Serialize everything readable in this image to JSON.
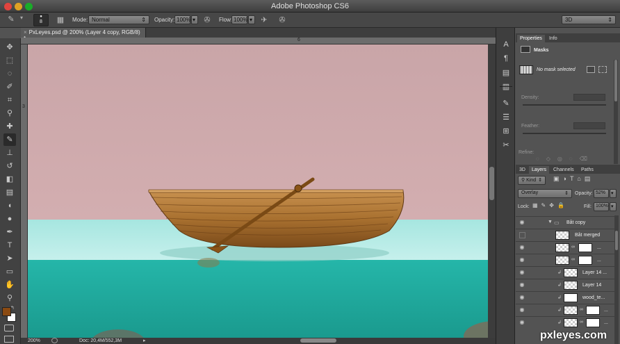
{
  "app": {
    "title": "Adobe Photoshop CS6",
    "workspace": "3D"
  },
  "options": {
    "brush_size": "8",
    "mode_label": "Mode:",
    "mode_value": "Normal",
    "opacity_label": "Opacity:",
    "opacity_value": "100%",
    "flow_label": "Flow:",
    "flow_value": "100%"
  },
  "document": {
    "tab_label": "PxLeyes.psd @ 200% (Layer 4 copy, RGB/8) *",
    "ruler_mark_top": "6",
    "ruler_mark_left": "3",
    "zoom": "200%",
    "doc_size": "Doc: 20,4M/552,3M"
  },
  "properties": {
    "tabs": [
      "Properties",
      "Info"
    ],
    "section": "Masks",
    "mask_status": "No mask selected",
    "density_label": "Density:",
    "feather_label": "Feather:",
    "refine_label": "Refine:"
  },
  "layers_panel": {
    "tabs": [
      "3D",
      "Layers",
      "Channels",
      "Paths"
    ],
    "kind_label": "Kind",
    "blend_mode": "Overlay",
    "opacity_label": "Opacity:",
    "opacity_value": "52%",
    "lock_label": "Lock:",
    "fill_label": "Fill:",
    "fill_value": "100%",
    "layers": [
      {
        "name": "Båt copy"
      },
      {
        "name": "Båt merged"
      },
      {
        "name": "..."
      },
      {
        "name": "..."
      },
      {
        "name": "Layer 14 ..."
      },
      {
        "name": "Layer 14"
      },
      {
        "name": "wood_te..."
      },
      {
        "name": "..."
      },
      {
        "name": "..."
      }
    ]
  },
  "watermark": "pxleyes.com",
  "colors": {
    "foreground": "#8a4a12",
    "background": "#ffffff",
    "sky": "#cba7a9",
    "water": "#2bb5a6"
  }
}
